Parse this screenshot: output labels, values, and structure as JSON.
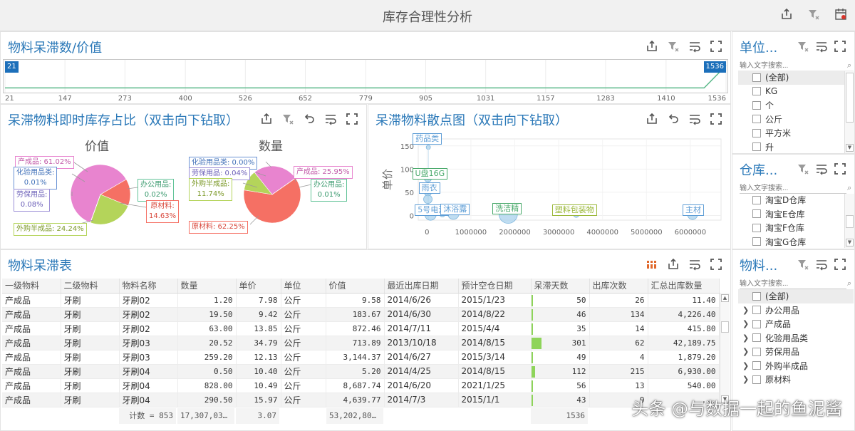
{
  "app": {
    "title": "库存合理性分析"
  },
  "colors": {
    "accent": "#2a78b8",
    "badge": "#1c6fba",
    "line": "#5bb98a",
    "bar": "#8ed45a",
    "pie": {
      "产成品": "#e884cf",
      "原材料": "#f57064",
      "外购半成品": "#b4d45a",
      "化验用品类": "#6a92d4",
      "劳保用品": "#9b8fd6",
      "办公用品": "#62c398"
    }
  },
  "timeline": {
    "title": "物料呆滞数/价值",
    "start_badge": "21",
    "end_badge": "1536",
    "ticks": [
      "21",
      "147",
      "273",
      "400",
      "526",
      "652",
      "779",
      "905",
      "1031",
      "1157",
      "1283",
      "1410",
      "1536"
    ]
  },
  "pie_panel": {
    "title": "呆滞物料即时库存占比（双击向下钻取）",
    "value_heading": "价值",
    "qty_heading": "数量",
    "value_labels": {
      "product": "产成品: 61.02%",
      "lab_1": "化验用品类:",
      "lab_2": "0.01%",
      "labor_1": "劳保用品:",
      "labor_2": "0.08%",
      "office_1": "办公用品:",
      "office_2": "0.02%",
      "raw_1": "原材料:",
      "raw_2": "14.63%",
      "semi": "外购半成品: 24.24%"
    },
    "qty_labels": {
      "lab": "化验用品类: 0.00%",
      "labor": "劳保用品: 0.04%",
      "semi_1": "外购半成品:",
      "semi_2": "11.74%",
      "product": "产成品: 25.95%",
      "office_1": "办公用品:",
      "office_2": "0.01%",
      "raw": "原材料: 62.25%"
    }
  },
  "chart_data": [
    {
      "type": "line",
      "title": "物料呆滞数/价值",
      "x": [
        21,
        147,
        273,
        400,
        526,
        652,
        779,
        905,
        1031,
        1157,
        1283,
        1410,
        1490,
        1536
      ],
      "values": [
        2,
        2,
        2,
        2,
        2,
        2,
        2,
        2,
        2,
        2,
        2,
        2,
        2,
        100
      ],
      "ylim": [
        0,
        100
      ]
    },
    {
      "type": "pie",
      "title": "价值",
      "labels": [
        "产成品",
        "原材料",
        "外购半成品",
        "化验用品类",
        "劳保用品",
        "办公用品"
      ],
      "values": [
        61.02,
        14.63,
        24.24,
        0.01,
        0.08,
        0.02
      ]
    },
    {
      "type": "pie",
      "title": "数量",
      "labels": [
        "原材料",
        "外购半成品",
        "产成品",
        "化验用品类",
        "劳保用品",
        "办公用品"
      ],
      "values": [
        62.25,
        11.74,
        25.95,
        0.0,
        0.04,
        0.01
      ]
    },
    {
      "type": "scatter",
      "title": "呆滞物料散点图（双击向下钻取）",
      "ylabel": "单价",
      "xlim": [
        -200000,
        6700000
      ],
      "ylim": [
        -10,
        165
      ],
      "xticks": [
        "0",
        "1000000",
        "2000000",
        "3000000",
        "4000000",
        "5000000",
        "6000000"
      ],
      "yticks": [
        "0",
        "50",
        "100",
        "150"
      ],
      "points": [
        {
          "x": 30000,
          "y": 147,
          "r": 3,
          "label": "药品类"
        },
        {
          "x": 20000,
          "y": 80,
          "r": 5,
          "label": "U盘16G"
        },
        {
          "x": 20000,
          "y": 50,
          "r": 5,
          "label": "雨衣"
        },
        {
          "x": 20000,
          "y": 35,
          "r": 6,
          "label": ""
        },
        {
          "x": 80000,
          "y": 2,
          "r": 8,
          "label": "5号电池"
        },
        {
          "x": 350000,
          "y": 3,
          "r": 4,
          "label": ""
        },
        {
          "x": 600000,
          "y": 4,
          "r": 8,
          "label": "沐浴露"
        },
        {
          "x": 1850000,
          "y": 3,
          "r": 13,
          "label": "洗洁精"
        },
        {
          "x": 3400000,
          "y": 2,
          "r": 4,
          "label": "塑料包装物"
        },
        {
          "x": 6050000,
          "y": 2,
          "r": 7,
          "label": "主材"
        }
      ]
    }
  ],
  "table": {
    "title": "物料呆滞表",
    "headers": [
      "一级物料",
      "二级物料",
      "物料名称",
      "数量",
      "单价",
      "单位",
      "价值",
      "最近出库日期",
      "预计空仓日期",
      "呆滞天数",
      "出库次数",
      "汇总出库数量"
    ],
    "rows": [
      [
        "产成品",
        "牙刷",
        "牙刷02",
        "1.20",
        "7.98",
        "公斤",
        "9.58",
        "2014/6/26",
        "2015/1/23",
        "50",
        "26",
        "11.40"
      ],
      [
        "产成品",
        "牙刷",
        "牙刷02",
        "19.50",
        "9.42",
        "公斤",
        "183.67",
        "2014/6/30",
        "2014/8/22",
        "46",
        "134",
        "4,226.40"
      ],
      [
        "产成品",
        "牙刷",
        "牙刷02",
        "63.00",
        "13.85",
        "公斤",
        "872.46",
        "2014/7/11",
        "2015/4/4",
        "35",
        "14",
        "415.80"
      ],
      [
        "产成品",
        "牙刷",
        "牙刷03",
        "20.52",
        "34.79",
        "公斤",
        "713.89",
        "2013/10/18",
        "2014/8/15",
        "301",
        "62",
        "42,189.75"
      ],
      [
        "产成品",
        "牙刷",
        "牙刷03",
        "259.20",
        "12.13",
        "公斤",
        "3,144.37",
        "2014/6/27",
        "2015/3/14",
        "49",
        "4",
        "1,879.20"
      ],
      [
        "产成品",
        "牙刷",
        "牙刷04",
        "0.50",
        "10.40",
        "公斤",
        "5.20",
        "2014/4/25",
        "2014/8/15",
        "112",
        "215",
        "6,930.00"
      ],
      [
        "产成品",
        "牙刷",
        "牙刷04",
        "828.00",
        "10.49",
        "公斤",
        "8,687.74",
        "2014/6/20",
        "2021/1/25",
        "56",
        "13",
        "540.00"
      ],
      [
        "产成品",
        "牙刷",
        "牙刷04",
        "290.50",
        "15.97",
        "公斤",
        "4,639.77",
        "2014/7/3",
        "2015/1/1",
        "43",
        "9",
        "..."
      ]
    ],
    "footer": {
      "count": "计数 = 853",
      "qty": "17,307,03…",
      "price": "3.07",
      "value": "53,202,80…",
      "days": "1536"
    }
  },
  "filters": {
    "unit": {
      "title": "单位...",
      "placeholder": "输入文字搜索...",
      "items": [
        "(全部)",
        "KG",
        "个",
        "公斤",
        "平方米",
        "升"
      ]
    },
    "warehouse": {
      "title": "仓库...",
      "placeholder": "输入文字搜索...",
      "items": [
        "淘宝D仓库",
        "淘宝E仓库",
        "淘宝F仓库",
        "淘宝G仓库"
      ]
    },
    "material": {
      "title": "物料...",
      "placeholder": "输入文字搜索...",
      "items": [
        "(全部)",
        "办公用品",
        "产成品",
        "化验用品类",
        "劳保用品",
        "外购半成品",
        "原材料"
      ]
    }
  },
  "watermark": "头条 @与数据一起的鱼泥酱"
}
